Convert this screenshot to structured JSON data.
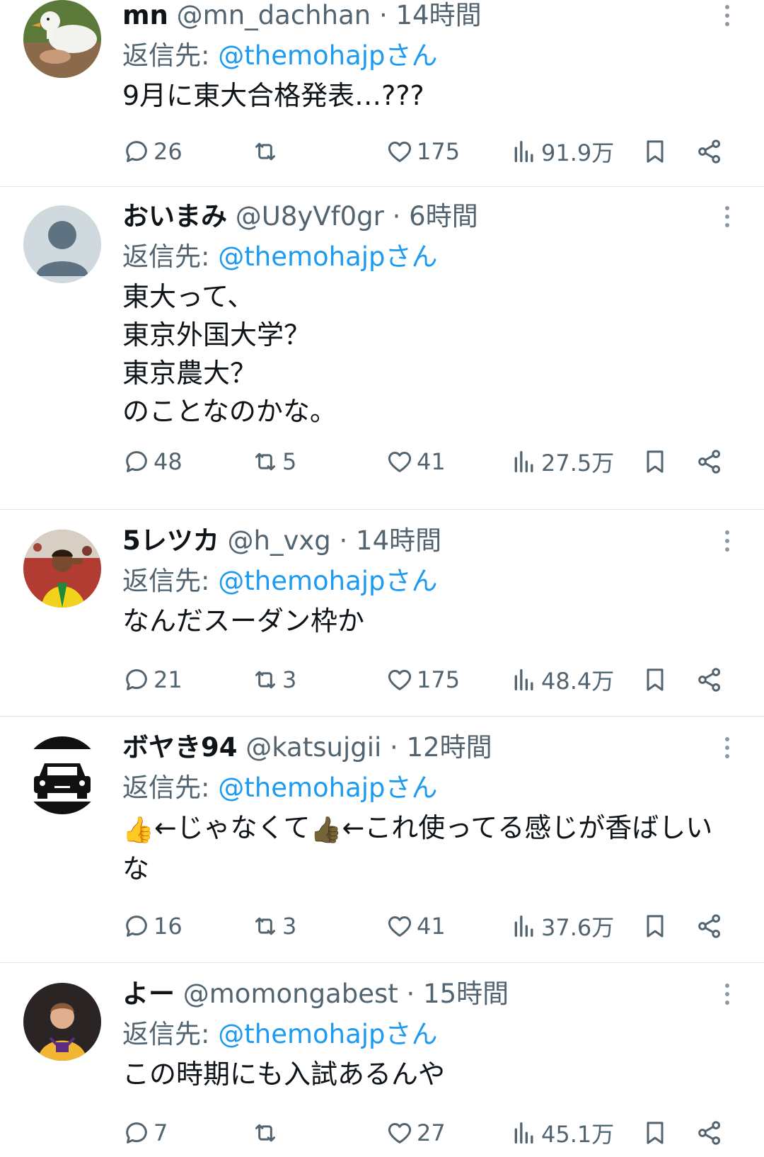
{
  "tweets": [
    {
      "display_name": "mn",
      "handle": "@mn_dachhan",
      "separator": " · ",
      "time": "14時間",
      "reply_prefix": "返信先: ",
      "reply_to": "@themohajp",
      "reply_suffix": "さん",
      "text": "9月に東大合格発表…???",
      "reply_count": "26",
      "retweet_count": "",
      "like_count": "175",
      "view_count": "91.9万",
      "avatar": "duck-avatar"
    },
    {
      "display_name": "おいまみ",
      "handle": "@U8yVf0gr",
      "separator": " · ",
      "time": "6時間",
      "reply_prefix": "返信先: ",
      "reply_to": "@themohajp",
      "reply_suffix": "さん",
      "text": "東大って、\n東京外国大学？\n東京農大？\nのことなのかな。",
      "reply_count": "48",
      "retweet_count": "5",
      "like_count": "41",
      "view_count": "27.5万",
      "avatar": "default-avatar"
    },
    {
      "display_name": "5レツカ",
      "handle": "@h_vxg",
      "separator": " · ",
      "time": "14時間",
      "reply_prefix": "返信先: ",
      "reply_to": "@themohajp",
      "reply_suffix": "さん",
      "text": "なんだスーダン枠か",
      "reply_count": "21",
      "retweet_count": "3",
      "like_count": "175",
      "view_count": "48.4万",
      "avatar": "soccer-player-avatar"
    },
    {
      "display_name": "ボヤき94",
      "handle": "@katsujgii",
      "separator": " · ",
      "time": "12時間",
      "reply_prefix": "返信先: ",
      "reply_to": "@themohajp",
      "reply_suffix": "さん",
      "text_part1": "←じゃなくて",
      "text_part2": "←これ使ってる感じが香ばしいな",
      "thumb_emoji": "👍",
      "reply_count": "16",
      "retweet_count": "3",
      "like_count": "41",
      "view_count": "37.6万",
      "avatar": "car-avatar"
    },
    {
      "display_name": "よー",
      "handle": "@momongabest",
      "separator": " · ",
      "time": "15時間",
      "reply_prefix": "返信先: ",
      "reply_to": "@themohajp",
      "reply_suffix": "さん",
      "text": "この時期にも入試あるんや",
      "reply_count": "7",
      "retweet_count": "",
      "like_count": "27",
      "view_count": "45.1万",
      "avatar": "basketball-player-avatar"
    }
  ],
  "colors": {
    "link": "#1d9bf0",
    "secondary_text": "#536471",
    "primary_text": "#0f1419",
    "divider": "#e1e5e8"
  }
}
